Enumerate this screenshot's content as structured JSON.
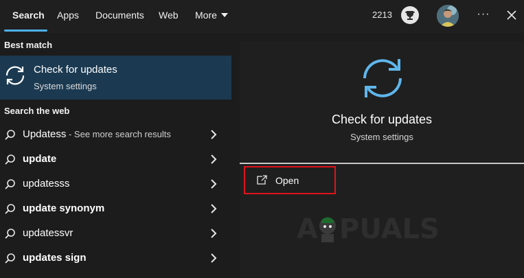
{
  "tabs": [
    {
      "label": "Search",
      "active": true
    },
    {
      "label": "Apps",
      "active": false
    },
    {
      "label": "Documents",
      "active": false
    },
    {
      "label": "Web",
      "active": false
    },
    {
      "label": "More",
      "active": false
    }
  ],
  "header": {
    "points": "2213",
    "trophy_icon": "trophy-icon",
    "avatar_icon": "user-avatar",
    "more_options": "···"
  },
  "best_match": {
    "section_title": "Best match",
    "title": "Check for updates",
    "subtitle": "System settings",
    "icon": "sync-icon"
  },
  "web": {
    "section_title": "Search the web",
    "results": [
      {
        "text": "Updatess",
        "suffix": " - See more search results",
        "bold": false
      },
      {
        "text": "update",
        "suffix": "",
        "bold": true
      },
      {
        "text": "updatesss",
        "suffix": "",
        "bold": false
      },
      {
        "text": "update synonym",
        "suffix": "",
        "bold": true
      },
      {
        "text": "updatessvr",
        "suffix": "",
        "bold": false
      },
      {
        "text": "updates sign",
        "suffix": "",
        "bold": true
      }
    ]
  },
  "detail": {
    "title": "Check for updates",
    "subtitle": "System settings",
    "open_label": "Open",
    "highlight_color": "#e0141b"
  },
  "watermark": {
    "brand": "APPUALS"
  },
  "colors": {
    "accent": "#4fb0ea",
    "selected_bg": "#1b3a52",
    "background": "#1c1c1c"
  }
}
